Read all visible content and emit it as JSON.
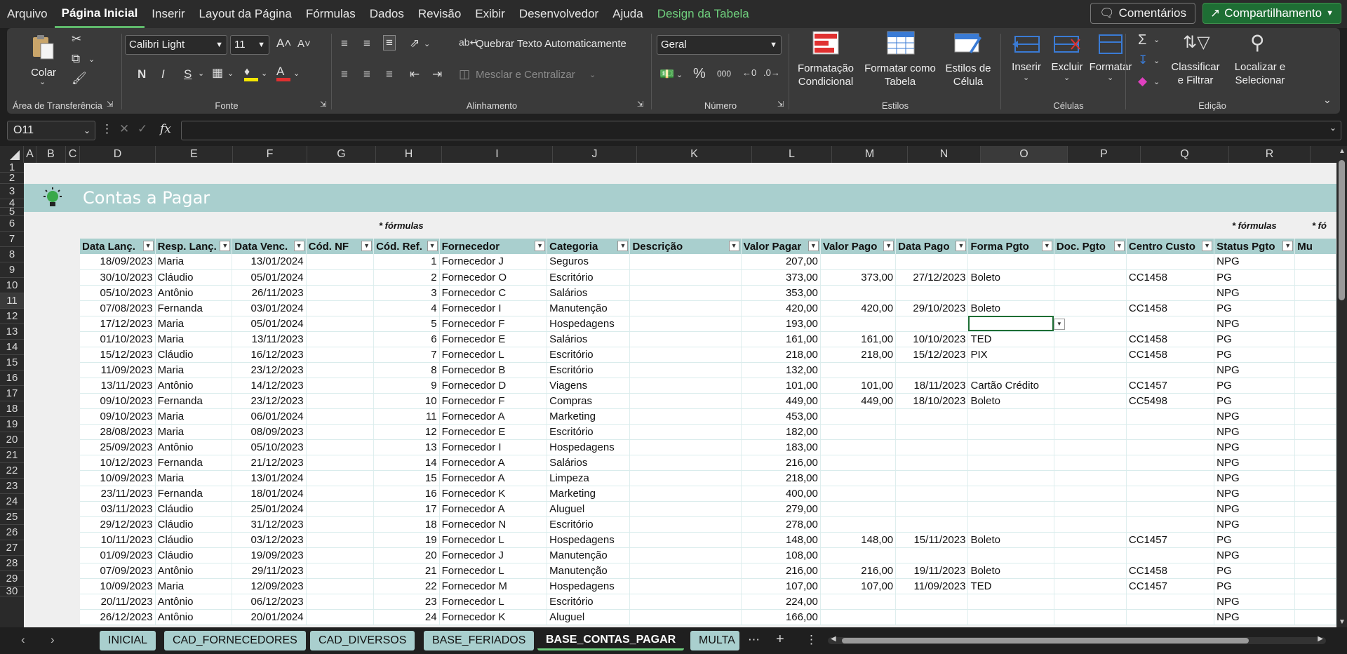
{
  "menu": {
    "items": [
      "Arquivo",
      "Página Inicial",
      "Inserir",
      "Layout da Página",
      "Fórmulas",
      "Dados",
      "Revisão",
      "Exibir",
      "Desenvolvedor",
      "Ajuda",
      "Design da Tabela"
    ],
    "comments_label": "Comentários",
    "share_label": "Compartilhamento"
  },
  "ribbon": {
    "clipboard": {
      "paste": "Colar",
      "label": "Área de Transferência"
    },
    "font": {
      "name": "Calibri Light",
      "size": "11",
      "label": "Fonte",
      "bold": "N",
      "italic": "I",
      "underline": "S"
    },
    "alignment": {
      "wrap": "Quebrar Texto Automaticamente",
      "merge": "Mesclar e Centralizar",
      "label": "Alinhamento"
    },
    "number": {
      "format": "Geral",
      "label": "Número",
      "percent": "%",
      "thousands": "000"
    },
    "styles": {
      "conditional": "Formatação\nCondicional",
      "as_table": "Formatar como\nTabela",
      "cell_styles": "Estilos de\nCélula",
      "label": "Estilos"
    },
    "cells": {
      "insert": "Inserir",
      "delete": "Excluir",
      "format": "Formatar",
      "label": "Células"
    },
    "editing": {
      "sort": "Classificar\ne Filtrar",
      "find": "Localizar e\nSelecionar",
      "label": "Edição"
    }
  },
  "formula_bar": {
    "name_box": "O11",
    "fx": "fx",
    "value": ""
  },
  "columns": [
    "A",
    "B",
    "C",
    "D",
    "E",
    "F",
    "G",
    "H",
    "I",
    "J",
    "K",
    "L",
    "M",
    "N",
    "O",
    "P",
    "Q",
    "R"
  ],
  "rows": [
    "1",
    "2",
    "3",
    "4",
    "5",
    "6",
    "7",
    "8",
    "9",
    "10",
    "11",
    "12",
    "13",
    "14",
    "15",
    "16",
    "17",
    "18",
    "19",
    "20",
    "21",
    "22",
    "23",
    "24",
    "25",
    "26",
    "27",
    "28",
    "29",
    "30"
  ],
  "sheet": {
    "title": "Contas a Pagar",
    "note1": "* fórmulas",
    "note2": "* fórmulas",
    "note3": "* fó",
    "headers": [
      "Data Lanç.",
      "Resp. Lanç.",
      "Data Venc.",
      "Cód. NF",
      "Cód. Ref.",
      "Fornecedor",
      "Categoria",
      "Descrição",
      "Valor Pagar",
      "Valor Pago",
      "Data Pago",
      "Forma Pgto",
      "Doc. Pgto",
      "Centro Custo",
      "Status Pgto",
      "Mu"
    ],
    "data": [
      [
        "18/09/2023",
        "Maria",
        "13/01/2024",
        "",
        "1",
        "Fornecedor J",
        "Seguros",
        "",
        "207,00",
        "",
        "",
        "",
        "",
        "",
        "NPG",
        ""
      ],
      [
        "30/10/2023",
        "Cláudio",
        "05/01/2024",
        "",
        "2",
        "Fornecedor O",
        "Escritório",
        "",
        "373,00",
        "373,00",
        "27/12/2023",
        "Boleto",
        "",
        "CC1458",
        "PG",
        ""
      ],
      [
        "05/10/2023",
        "Antônio",
        "26/11/2023",
        "",
        "3",
        "Fornecedor C",
        "Salários",
        "",
        "353,00",
        "",
        "",
        "",
        "",
        "",
        "NPG",
        ""
      ],
      [
        "07/08/2023",
        "Fernanda",
        "03/01/2024",
        "",
        "4",
        "Fornecedor I",
        "Manutenção",
        "",
        "420,00",
        "420,00",
        "29/10/2023",
        "Boleto",
        "",
        "CC1458",
        "PG",
        ""
      ],
      [
        "17/12/2023",
        "Maria",
        "05/01/2024",
        "",
        "5",
        "Fornecedor F",
        "Hospedagens",
        "",
        "193,00",
        "",
        "",
        "",
        "",
        "",
        "NPG",
        ""
      ],
      [
        "01/10/2023",
        "Maria",
        "13/11/2023",
        "",
        "6",
        "Fornecedor E",
        "Salários",
        "",
        "161,00",
        "161,00",
        "10/10/2023",
        "TED",
        "",
        "CC1458",
        "PG",
        ""
      ],
      [
        "15/12/2023",
        "Cláudio",
        "16/12/2023",
        "",
        "7",
        "Fornecedor L",
        "Escritório",
        "",
        "218,00",
        "218,00",
        "15/12/2023",
        "PIX",
        "",
        "CC1458",
        "PG",
        ""
      ],
      [
        "11/09/2023",
        "Maria",
        "23/12/2023",
        "",
        "8",
        "Fornecedor B",
        "Escritório",
        "",
        "132,00",
        "",
        "",
        "",
        "",
        "",
        "NPG",
        ""
      ],
      [
        "13/11/2023",
        "Antônio",
        "14/12/2023",
        "",
        "9",
        "Fornecedor D",
        "Viagens",
        "",
        "101,00",
        "101,00",
        "18/11/2023",
        "Cartão Crédito",
        "",
        "CC1457",
        "PG",
        ""
      ],
      [
        "09/10/2023",
        "Fernanda",
        "23/12/2023",
        "",
        "10",
        "Fornecedor F",
        "Compras",
        "",
        "449,00",
        "449,00",
        "18/10/2023",
        "Boleto",
        "",
        "CC5498",
        "PG",
        ""
      ],
      [
        "09/10/2023",
        "Maria",
        "06/01/2024",
        "",
        "11",
        "Fornecedor A",
        "Marketing",
        "",
        "453,00",
        "",
        "",
        "",
        "",
        "",
        "NPG",
        ""
      ],
      [
        "28/08/2023",
        "Maria",
        "08/09/2023",
        "",
        "12",
        "Fornecedor E",
        "Escritório",
        "",
        "182,00",
        "",
        "",
        "",
        "",
        "",
        "NPG",
        ""
      ],
      [
        "25/09/2023",
        "Antônio",
        "05/10/2023",
        "",
        "13",
        "Fornecedor I",
        "Hospedagens",
        "",
        "183,00",
        "",
        "",
        "",
        "",
        "",
        "NPG",
        ""
      ],
      [
        "10/12/2023",
        "Fernanda",
        "21/12/2023",
        "",
        "14",
        "Fornecedor A",
        "Salários",
        "",
        "216,00",
        "",
        "",
        "",
        "",
        "",
        "NPG",
        ""
      ],
      [
        "10/09/2023",
        "Maria",
        "13/01/2024",
        "",
        "15",
        "Fornecedor A",
        "Limpeza",
        "",
        "218,00",
        "",
        "",
        "",
        "",
        "",
        "NPG",
        ""
      ],
      [
        "23/11/2023",
        "Fernanda",
        "18/01/2024",
        "",
        "16",
        "Fornecedor K",
        "Marketing",
        "",
        "400,00",
        "",
        "",
        "",
        "",
        "",
        "NPG",
        ""
      ],
      [
        "03/11/2023",
        "Cláudio",
        "25/01/2024",
        "",
        "17",
        "Fornecedor A",
        "Aluguel",
        "",
        "279,00",
        "",
        "",
        "",
        "",
        "",
        "NPG",
        ""
      ],
      [
        "29/12/2023",
        "Cláudio",
        "31/12/2023",
        "",
        "18",
        "Fornecedor N",
        "Escritório",
        "",
        "278,00",
        "",
        "",
        "",
        "",
        "",
        "NPG",
        ""
      ],
      [
        "10/11/2023",
        "Cláudio",
        "03/12/2023",
        "",
        "19",
        "Fornecedor L",
        "Hospedagens",
        "",
        "148,00",
        "148,00",
        "15/11/2023",
        "Boleto",
        "",
        "CC1457",
        "PG",
        ""
      ],
      [
        "01/09/2023",
        "Cláudio",
        "19/09/2023",
        "",
        "20",
        "Fornecedor J",
        "Manutenção",
        "",
        "108,00",
        "",
        "",
        "",
        "",
        "",
        "NPG",
        ""
      ],
      [
        "07/09/2023",
        "Antônio",
        "29/11/2023",
        "",
        "21",
        "Fornecedor L",
        "Manutenção",
        "",
        "216,00",
        "216,00",
        "19/11/2023",
        "Boleto",
        "",
        "CC1458",
        "PG",
        ""
      ],
      [
        "10/09/2023",
        "Maria",
        "12/09/2023",
        "",
        "22",
        "Fornecedor M",
        "Hospedagens",
        "",
        "107,00",
        "107,00",
        "11/09/2023",
        "TED",
        "",
        "CC1457",
        "PG",
        ""
      ],
      [
        "20/11/2023",
        "Antônio",
        "06/12/2023",
        "",
        "23",
        "Fornecedor L",
        "Escritório",
        "",
        "224,00",
        "",
        "",
        "",
        "",
        "",
        "NPG",
        ""
      ],
      [
        "26/12/2023",
        "Antônio",
        "20/01/2024",
        "",
        "24",
        "Fornecedor K",
        "Aluguel",
        "",
        "166,00",
        "",
        "",
        "",
        "",
        "",
        "NPG",
        ""
      ]
    ]
  },
  "tabs": [
    "INICIAL",
    "CAD_FORNECEDORES",
    "CAD_DIVERSOS",
    "BASE_FERIADOS",
    "BASE_CONTAS_PAGAR",
    "MULTA"
  ],
  "active_tab": "BASE_CONTAS_PAGAR",
  "colors": {
    "header_teal": "#a9cfce",
    "accent_green": "#6fcf7d",
    "share_green": "#1e6e34"
  }
}
